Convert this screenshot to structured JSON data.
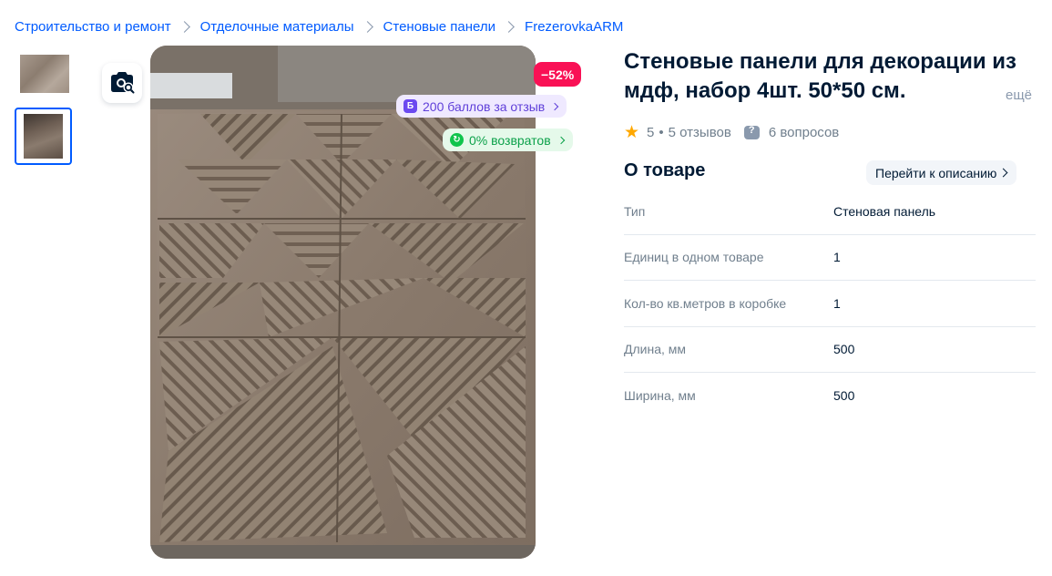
{
  "breadcrumbs": [
    {
      "label": "Строительство и ремонт"
    },
    {
      "label": "Отделочные материалы"
    },
    {
      "label": "Стеновые панели"
    },
    {
      "label": "FrezerovkaARM"
    }
  ],
  "gallery": {
    "thumbnails": [
      {
        "alt": "wall-panel-thumbnail-1"
      },
      {
        "alt": "wall-panel-thumbnail-2"
      }
    ],
    "selected_index": 1
  },
  "badges": {
    "discount": "−52%",
    "points_icon": "Б",
    "points": "200 баллов за отзыв",
    "returns": "0% возвратов"
  },
  "product": {
    "title": "Стеновые панели для декорации из мдф, набор 4шт. 50*50 см.",
    "more_label": "ещё",
    "rating": "5",
    "reviews": "5 отзывов",
    "separator": "•",
    "questions": "6 вопросов"
  },
  "about": {
    "heading": "О товаре",
    "to_description": "Перейти к описанию",
    "specs": [
      {
        "key": "Тип",
        "value": "Стеновая панель"
      },
      {
        "key": "Единиц в одном товаре",
        "value": "1"
      },
      {
        "key": "Кол-во кв.метров в коробке",
        "value": "1"
      },
      {
        "key": "Длина, мм",
        "value": "500"
      },
      {
        "key": "Ширина, мм",
        "value": "500"
      }
    ]
  },
  "colors": {
    "link": "#005bff",
    "discount": "#f91155",
    "points": "#6b49f0",
    "returns": "#10c44c",
    "star": "#ffa800",
    "text": "#001a34",
    "muted": "#707f8d"
  },
  "icons": {
    "breadcrumb_separator": "chevron-right-icon",
    "search_by_photo": "camera-search-icon",
    "star": "star-icon",
    "question": "question-icon"
  }
}
